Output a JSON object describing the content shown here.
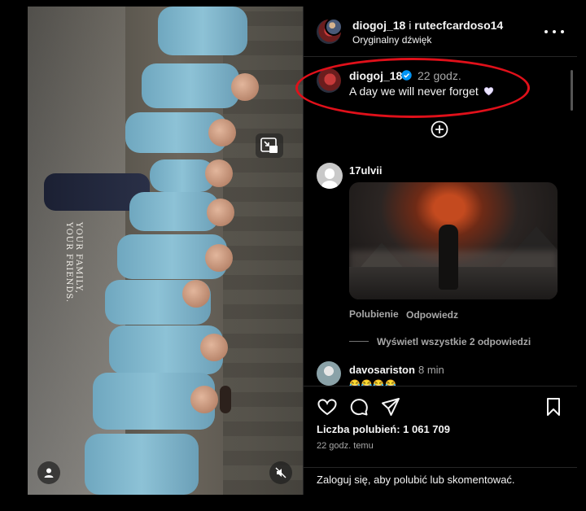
{
  "header": {
    "author": "diogoj_18",
    "separator": "i",
    "coauthor": "rutecfcardoso14",
    "audio": "Oryginalny dźwięk",
    "more_icon": "more-horizontal-icon"
  },
  "media": {
    "overlay_text_line1": "YOUR FAMILY,",
    "overlay_text_line2": "YOUR FRIENDS.",
    "pip_icon": "picture-in-picture-icon",
    "tag_icon": "user-tag-icon",
    "mute_icon": "muted-speaker-icon"
  },
  "caption": {
    "username": "diogoj_18",
    "verified_icon": "verified-badge-icon",
    "time": "22 godz.",
    "text": "A day we will never forget",
    "emoji": "white-heart-emoji"
  },
  "add_icon": "plus-circle-icon",
  "comments": [
    {
      "username": "17ulvii",
      "image_desc_icon": "dark-fantasy-knight-image",
      "like_label": "Polubienie",
      "reply_label": "Odpowiedz",
      "view_replies": "Wyświetl wszystkie 2 odpowiedzi"
    },
    {
      "username": "davosariston",
      "time": "8 min",
      "emojis": "😂😂😂😂"
    }
  ],
  "actions": {
    "like_icon": "heart-icon",
    "comment_icon": "comment-icon",
    "share_icon": "send-icon",
    "save_icon": "bookmark-icon",
    "likes_text": "Liczba polubień: 1 061 709",
    "posted": "22 godz. temu"
  },
  "footer": {
    "login_link": "Zaloguj się",
    "rest": ", aby polubić lub skomentować."
  },
  "colors": {
    "background": "#000000",
    "text": "#f5f5f5",
    "muted": "#a8a8a8",
    "verified": "#0095f6",
    "highlight_oval": "#e0101a"
  }
}
